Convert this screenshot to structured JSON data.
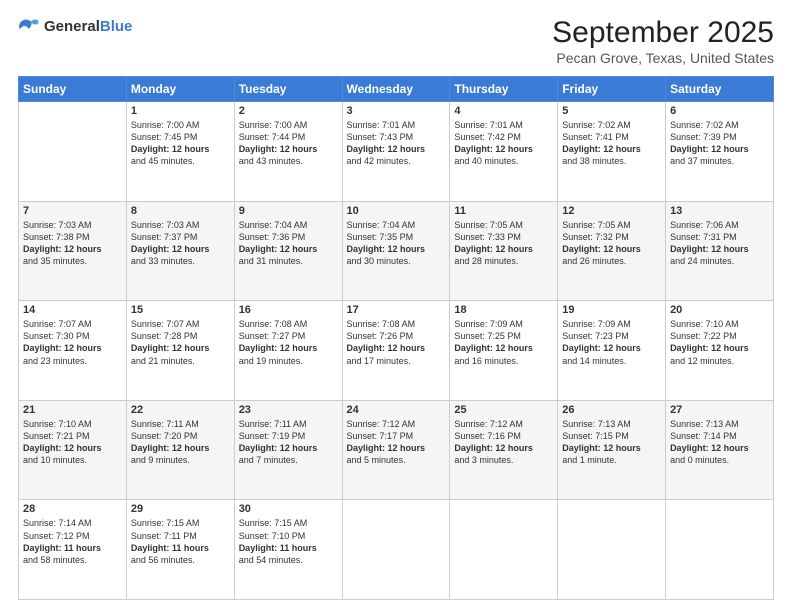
{
  "header": {
    "logo_general": "General",
    "logo_blue": "Blue",
    "month": "September 2025",
    "location": "Pecan Grove, Texas, United States"
  },
  "days_of_week": [
    "Sunday",
    "Monday",
    "Tuesday",
    "Wednesday",
    "Thursday",
    "Friday",
    "Saturday"
  ],
  "weeks": [
    [
      {
        "day": "",
        "content": ""
      },
      {
        "day": "1",
        "content": "Sunrise: 7:00 AM\nSunset: 7:45 PM\nDaylight: 12 hours\nand 45 minutes."
      },
      {
        "day": "2",
        "content": "Sunrise: 7:00 AM\nSunset: 7:44 PM\nDaylight: 12 hours\nand 43 minutes."
      },
      {
        "day": "3",
        "content": "Sunrise: 7:01 AM\nSunset: 7:43 PM\nDaylight: 12 hours\nand 42 minutes."
      },
      {
        "day": "4",
        "content": "Sunrise: 7:01 AM\nSunset: 7:42 PM\nDaylight: 12 hours\nand 40 minutes."
      },
      {
        "day": "5",
        "content": "Sunrise: 7:02 AM\nSunset: 7:41 PM\nDaylight: 12 hours\nand 38 minutes."
      },
      {
        "day": "6",
        "content": "Sunrise: 7:02 AM\nSunset: 7:39 PM\nDaylight: 12 hours\nand 37 minutes."
      }
    ],
    [
      {
        "day": "7",
        "content": "Sunrise: 7:03 AM\nSunset: 7:38 PM\nDaylight: 12 hours\nand 35 minutes."
      },
      {
        "day": "8",
        "content": "Sunrise: 7:03 AM\nSunset: 7:37 PM\nDaylight: 12 hours\nand 33 minutes."
      },
      {
        "day": "9",
        "content": "Sunrise: 7:04 AM\nSunset: 7:36 PM\nDaylight: 12 hours\nand 31 minutes."
      },
      {
        "day": "10",
        "content": "Sunrise: 7:04 AM\nSunset: 7:35 PM\nDaylight: 12 hours\nand 30 minutes."
      },
      {
        "day": "11",
        "content": "Sunrise: 7:05 AM\nSunset: 7:33 PM\nDaylight: 12 hours\nand 28 minutes."
      },
      {
        "day": "12",
        "content": "Sunrise: 7:05 AM\nSunset: 7:32 PM\nDaylight: 12 hours\nand 26 minutes."
      },
      {
        "day": "13",
        "content": "Sunrise: 7:06 AM\nSunset: 7:31 PM\nDaylight: 12 hours\nand 24 minutes."
      }
    ],
    [
      {
        "day": "14",
        "content": "Sunrise: 7:07 AM\nSunset: 7:30 PM\nDaylight: 12 hours\nand 23 minutes."
      },
      {
        "day": "15",
        "content": "Sunrise: 7:07 AM\nSunset: 7:28 PM\nDaylight: 12 hours\nand 21 minutes."
      },
      {
        "day": "16",
        "content": "Sunrise: 7:08 AM\nSunset: 7:27 PM\nDaylight: 12 hours\nand 19 minutes."
      },
      {
        "day": "17",
        "content": "Sunrise: 7:08 AM\nSunset: 7:26 PM\nDaylight: 12 hours\nand 17 minutes."
      },
      {
        "day": "18",
        "content": "Sunrise: 7:09 AM\nSunset: 7:25 PM\nDaylight: 12 hours\nand 16 minutes."
      },
      {
        "day": "19",
        "content": "Sunrise: 7:09 AM\nSunset: 7:23 PM\nDaylight: 12 hours\nand 14 minutes."
      },
      {
        "day": "20",
        "content": "Sunrise: 7:10 AM\nSunset: 7:22 PM\nDaylight: 12 hours\nand 12 minutes."
      }
    ],
    [
      {
        "day": "21",
        "content": "Sunrise: 7:10 AM\nSunset: 7:21 PM\nDaylight: 12 hours\nand 10 minutes."
      },
      {
        "day": "22",
        "content": "Sunrise: 7:11 AM\nSunset: 7:20 PM\nDaylight: 12 hours\nand 9 minutes."
      },
      {
        "day": "23",
        "content": "Sunrise: 7:11 AM\nSunset: 7:19 PM\nDaylight: 12 hours\nand 7 minutes."
      },
      {
        "day": "24",
        "content": "Sunrise: 7:12 AM\nSunset: 7:17 PM\nDaylight: 12 hours\nand 5 minutes."
      },
      {
        "day": "25",
        "content": "Sunrise: 7:12 AM\nSunset: 7:16 PM\nDaylight: 12 hours\nand 3 minutes."
      },
      {
        "day": "26",
        "content": "Sunrise: 7:13 AM\nSunset: 7:15 PM\nDaylight: 12 hours\nand 1 minute."
      },
      {
        "day": "27",
        "content": "Sunrise: 7:13 AM\nSunset: 7:14 PM\nDaylight: 12 hours\nand 0 minutes."
      }
    ],
    [
      {
        "day": "28",
        "content": "Sunrise: 7:14 AM\nSunset: 7:12 PM\nDaylight: 11 hours\nand 58 minutes."
      },
      {
        "day": "29",
        "content": "Sunrise: 7:15 AM\nSunset: 7:11 PM\nDaylight: 11 hours\nand 56 minutes."
      },
      {
        "day": "30",
        "content": "Sunrise: 7:15 AM\nSunset: 7:10 PM\nDaylight: 11 hours\nand 54 minutes."
      },
      {
        "day": "",
        "content": ""
      },
      {
        "day": "",
        "content": ""
      },
      {
        "day": "",
        "content": ""
      },
      {
        "day": "",
        "content": ""
      }
    ]
  ]
}
